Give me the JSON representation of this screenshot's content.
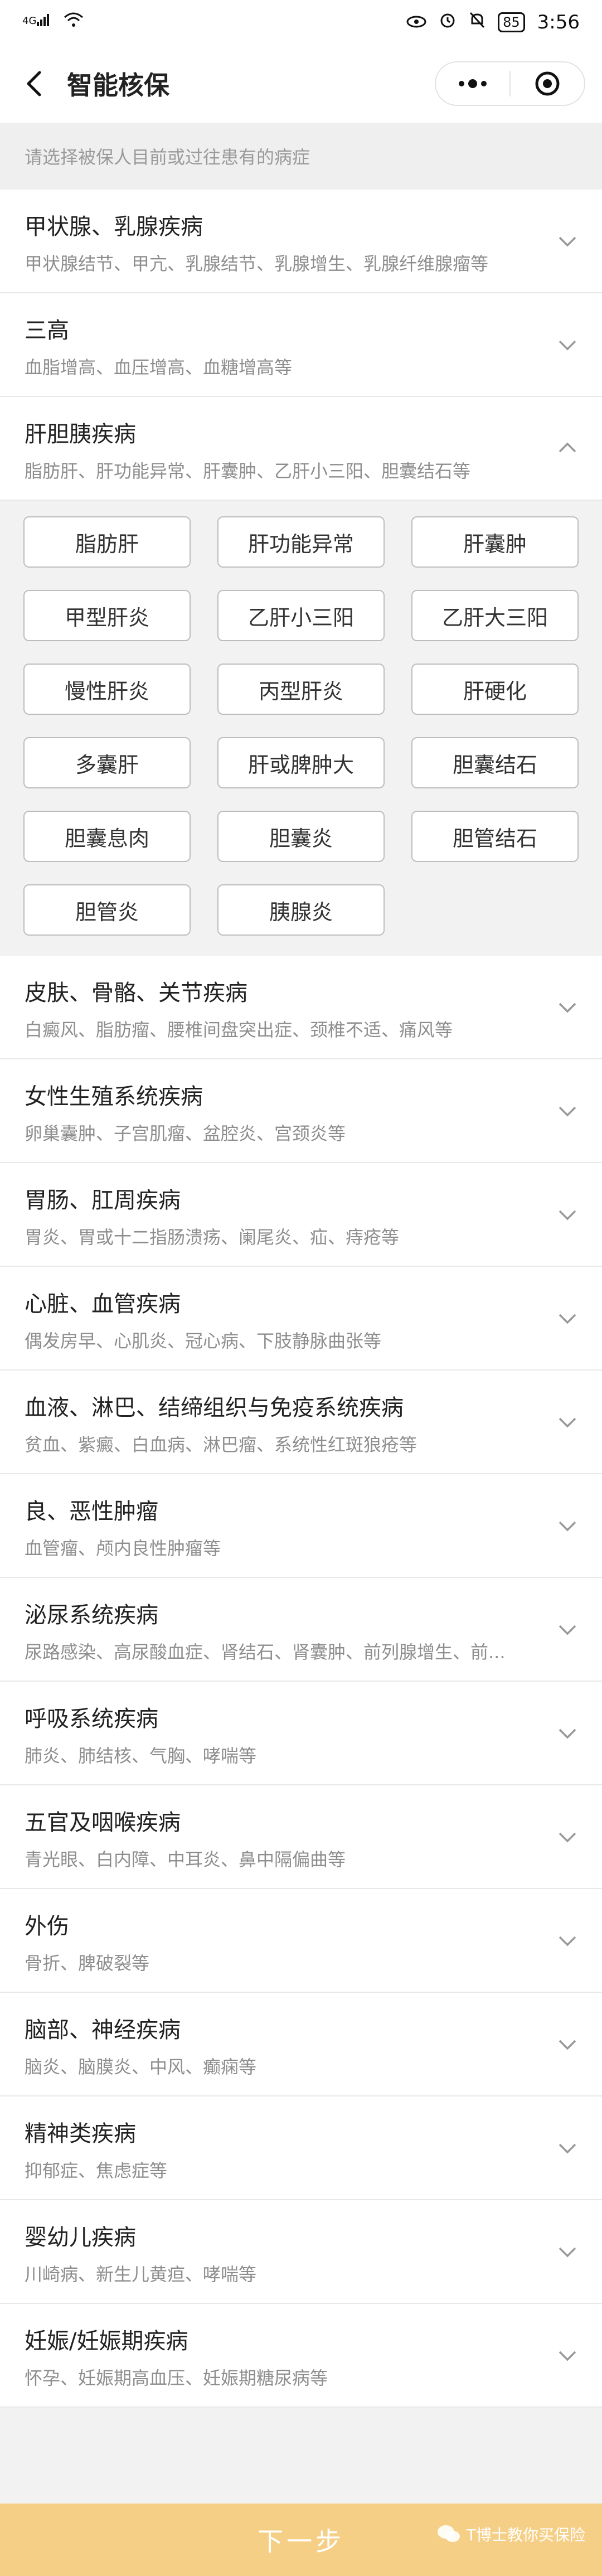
{
  "status": {
    "battery": "85",
    "time": "3:56"
  },
  "nav": {
    "title": "智能核保"
  },
  "hint": "请选择被保人目前或过往患有的病症",
  "categories": [
    {
      "title": "甲状腺、乳腺疾病",
      "desc": "甲状腺结节、甲亢、乳腺结节、乳腺增生、乳腺纤维腺瘤等"
    },
    {
      "title": "三高",
      "desc": "血脂增高、血压增高、血糖增高等"
    },
    {
      "title": "肝胆胰疾病",
      "desc": "脂肪肝、肝功能异常、肝囊肿、乙肝小三阳、胆囊结石等"
    },
    {
      "title": "皮肤、骨骼、关节疾病",
      "desc": "白癜风、脂肪瘤、腰椎间盘突出症、颈椎不适、痛风等"
    },
    {
      "title": "女性生殖系统疾病",
      "desc": "卵巢囊肿、子宫肌瘤、盆腔炎、宫颈炎等"
    },
    {
      "title": "胃肠、肛周疾病",
      "desc": "胃炎、胃或十二指肠溃疡、阑尾炎、疝、痔疮等"
    },
    {
      "title": "心脏、血管疾病",
      "desc": "偶发房早、心肌炎、冠心病、下肢静脉曲张等"
    },
    {
      "title": "血液、淋巴、结缔组织与免疫系统疾病",
      "desc": "贫血、紫癜、白血病、淋巴瘤、系统性红斑狼疮等"
    },
    {
      "title": "良、恶性肿瘤",
      "desc": "血管瘤、颅内良性肿瘤等"
    },
    {
      "title": "泌尿系统疾病",
      "desc": "尿路感染、高尿酸血症、肾结石、肾囊肿、前列腺增生、前..."
    },
    {
      "title": "呼吸系统疾病",
      "desc": "肺炎、肺结核、气胸、哮喘等"
    },
    {
      "title": "五官及咽喉疾病",
      "desc": "青光眼、白内障、中耳炎、鼻中隔偏曲等"
    },
    {
      "title": "外伤",
      "desc": "骨折、脾破裂等"
    },
    {
      "title": "脑部、神经疾病",
      "desc": "脑炎、脑膜炎、中风、癫痫等"
    },
    {
      "title": "精神类疾病",
      "desc": "抑郁症、焦虑症等"
    },
    {
      "title": "婴幼儿疾病",
      "desc": "川崎病、新生儿黄疸、哮喘等"
    },
    {
      "title": "妊娠/妊娠期疾病",
      "desc": "怀孕、妊娠期高血压、妊娠期糖尿病等"
    }
  ],
  "liver_tags": [
    "脂肪肝",
    "肝功能异常",
    "肝囊肿",
    "甲型肝炎",
    "乙肝小三阳",
    "乙肝大三阳",
    "慢性肝炎",
    "丙型肝炎",
    "肝硬化",
    "多囊肝",
    "肝或脾肿大",
    "胆囊结石",
    "胆囊息肉",
    "胆囊炎",
    "胆管结石",
    "胆管炎",
    "胰腺炎"
  ],
  "next_button": "下一步",
  "watermark": "T博士教你买保险"
}
